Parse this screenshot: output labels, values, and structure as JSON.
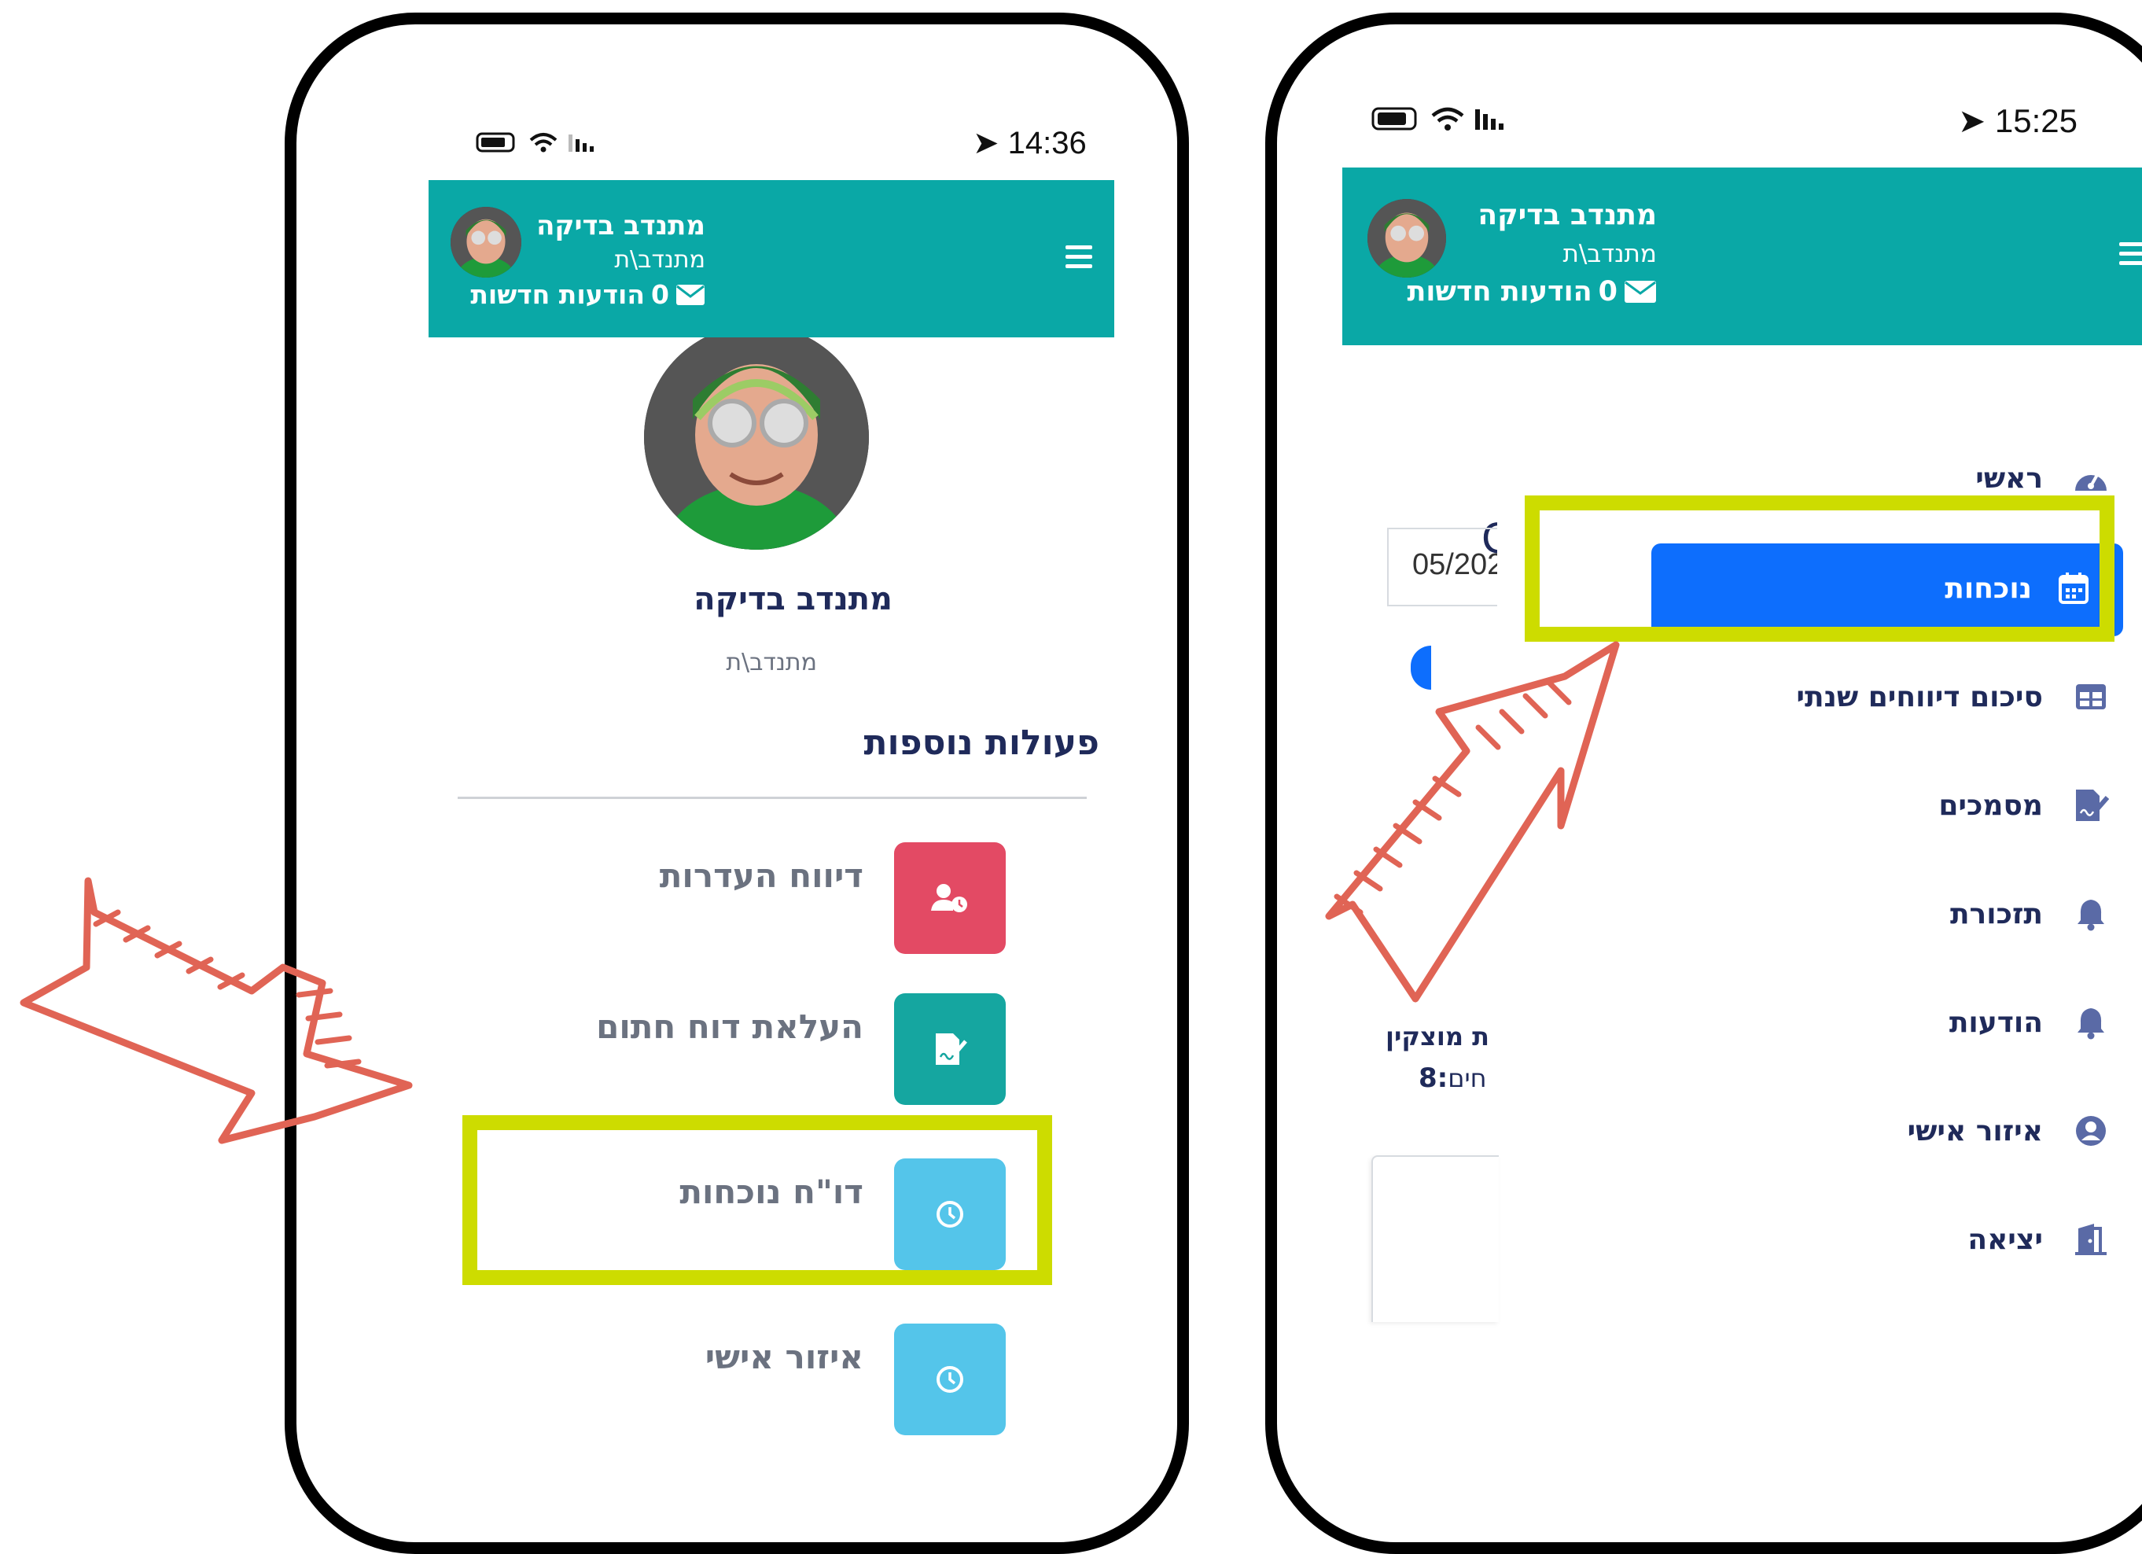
{
  "left_screen": {
    "status": {
      "time": "14:36"
    },
    "header": {
      "name": "מתנדב בדיקה",
      "role": "מתנדב\\ת",
      "messages_count": "0",
      "messages_label": "הודעות חדשות"
    },
    "profile": {
      "name": "מתנדב בדיקה",
      "role": "מתנדב\\ת"
    },
    "section_title": "פעולות נוספות",
    "actions": [
      {
        "label": "דיווח העדרות",
        "color": "#e34a64",
        "icon": "user-clock-icon"
      },
      {
        "label": "העלאת דוח חתום",
        "color": "#15a6a0",
        "icon": "signature-doc-icon"
      },
      {
        "label": "דו\"ח נוכחות",
        "color": "#54c5ea",
        "icon": "clock-icon"
      },
      {
        "label": "איזור אישי",
        "color": "#54c5ea",
        "icon": "clock-icon"
      }
    ]
  },
  "right_screen": {
    "status": {
      "time": "15:25"
    },
    "header": {
      "name": "מתנדב בדיקה",
      "role": "מתנדב\\ת",
      "messages_count": "0",
      "messages_label": "הודעות חדשות"
    },
    "background_fragments": {
      "letter": "C",
      "date": "05/202",
      "line1": "ת מוצקין",
      "line2_prefix": "8:",
      "line2_suffix": "חים"
    },
    "menu": [
      {
        "label": "ראשי",
        "icon": "dashboard-icon"
      },
      {
        "label": "נוכחות",
        "icon": "calendar-icon",
        "active": true
      },
      {
        "label": "סיכום דיווחים שנתי",
        "icon": "table-icon"
      },
      {
        "label": "מסמכים",
        "icon": "document-signature-icon"
      },
      {
        "label": "תזכורת",
        "icon": "bell-icon"
      },
      {
        "label": "הודעות",
        "icon": "bell-icon"
      },
      {
        "label": "איזור אישי",
        "icon": "user-circle-icon"
      },
      {
        "label": "יציאה",
        "icon": "door-icon"
      }
    ]
  },
  "colors": {
    "teal": "#0aa8a6",
    "highlight": "#cddc00",
    "active_blue": "#0d6efd",
    "arrow": "#e06455"
  }
}
